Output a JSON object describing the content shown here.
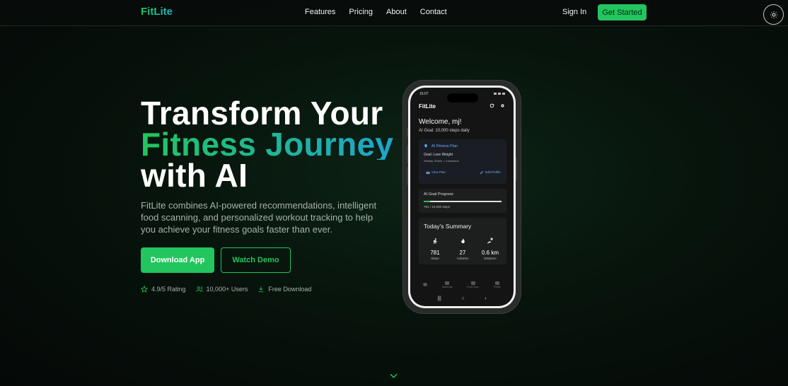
{
  "brand": {
    "logo": "FitLite",
    "accent": "#22c55e",
    "accent2": "#1ea5cf"
  },
  "nav": {
    "links": [
      "Features",
      "Pricing",
      "About",
      "Contact"
    ],
    "sign_in": "Sign In",
    "get_started": "Get Started",
    "theme_toggle_icon": "sun-icon"
  },
  "hero": {
    "title_line1": "Transform Your",
    "title_line2": "Fitness Journey",
    "title_line3": "with AI",
    "description": "FitLite combines AI-powered recommendations, intelligent food scanning, and personalized workout tracking to help you achieve your fitness goals faster than ever.",
    "download_button": "Download App",
    "demo_button": "Watch Demo",
    "stats": [
      {
        "icon": "star-icon",
        "label": "4.9/5 Rating"
      },
      {
        "icon": "users-icon",
        "label": "10,000+ Users"
      },
      {
        "icon": "download-icon",
        "label": "Free Download"
      }
    ]
  },
  "phone": {
    "time": "16:07",
    "app_title": "FitLite",
    "welcome": "Welcome, mj!",
    "ai_goal": "AI Goal: 10,000 steps daily",
    "plan_card": {
      "title": "AI Fitness Plan",
      "goal": "Goal: Lose Weight",
      "weekly": "Weekly: 50min × 4 sessions",
      "view_plan": "View Plan",
      "edit_profile": "Edit Profile"
    },
    "progress_card": {
      "title": "AI Goal Progress",
      "value": "781 / 10,000 steps",
      "fraction": 0.078
    },
    "summary": {
      "title": "Today's Summary",
      "items": [
        {
          "icon": "walk-icon",
          "value": "781",
          "label": "Steps"
        },
        {
          "icon": "flame-icon",
          "value": "27",
          "label": "Calories"
        },
        {
          "icon": "distance-icon",
          "value": "0.6 km",
          "label": "Distance"
        }
      ]
    },
    "bottom_nav": [
      "",
      "Workouts",
      "Food Scan",
      "Profile"
    ],
    "system_nav": [
      "|||",
      "○",
      "‹"
    ]
  }
}
